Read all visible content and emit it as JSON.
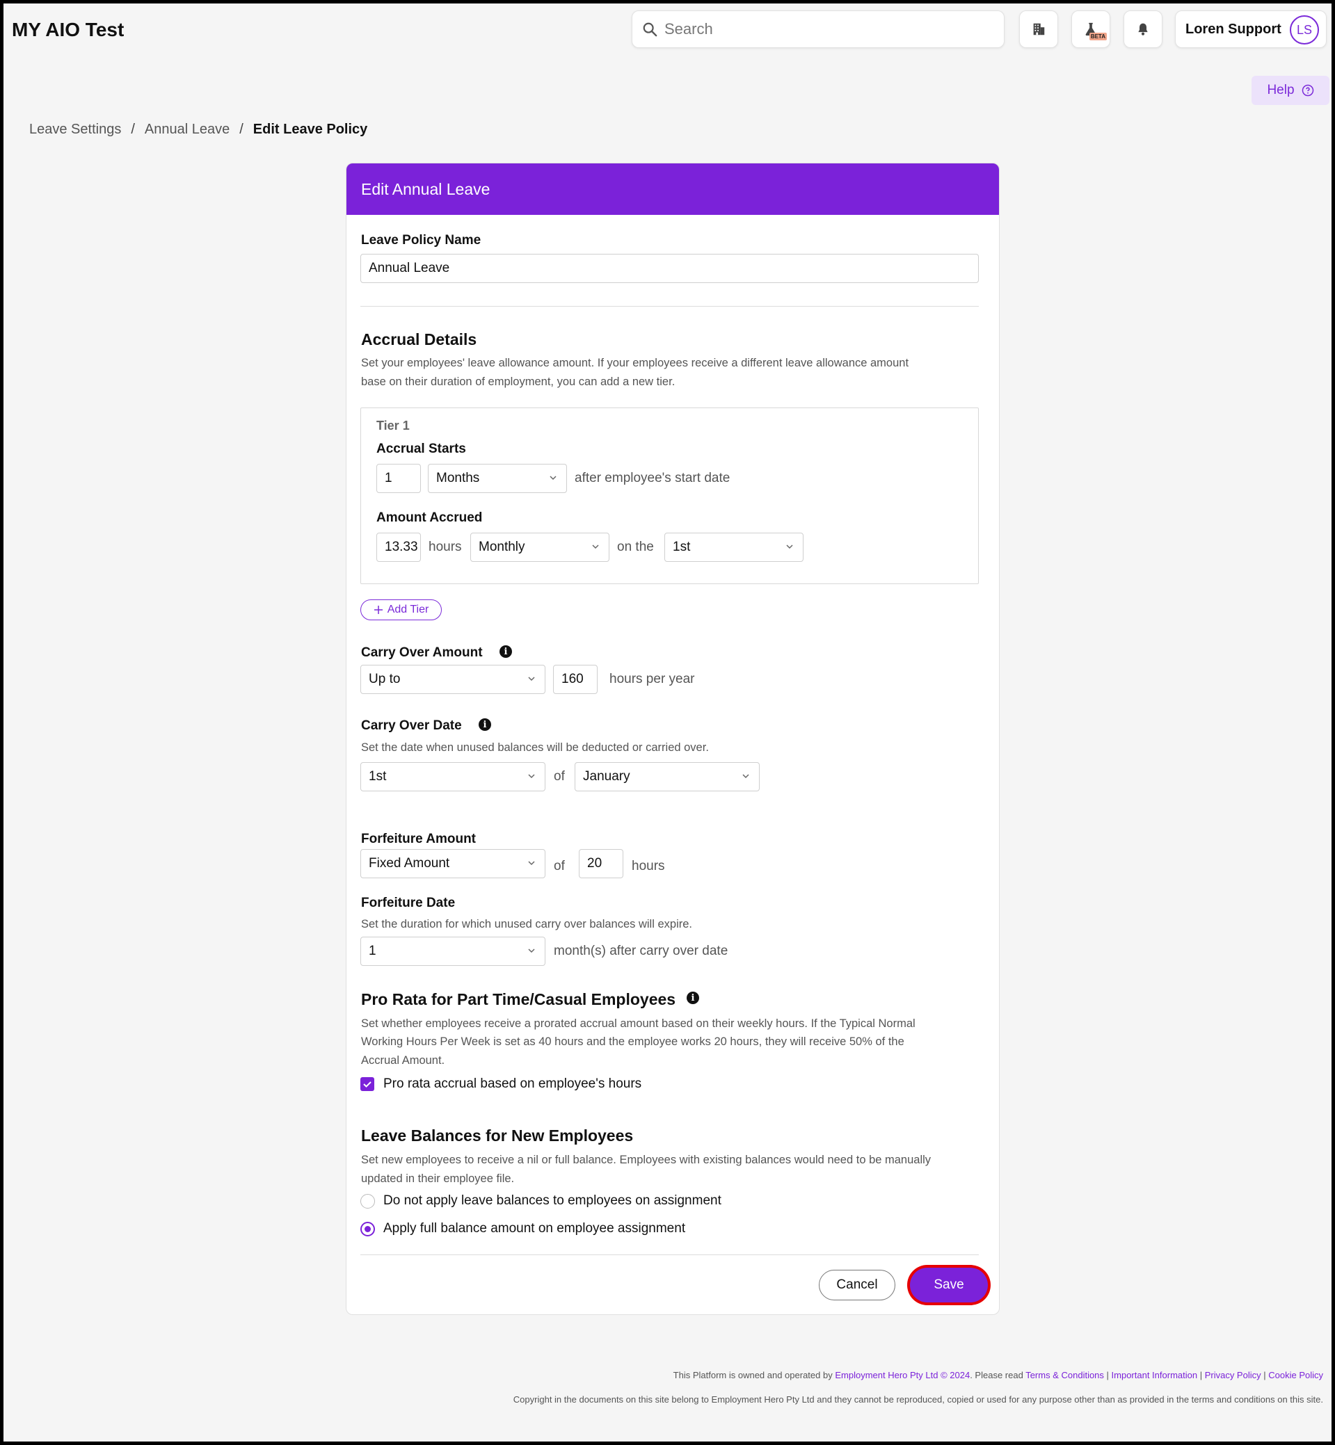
{
  "app": {
    "title": "MY AIO Test"
  },
  "search": {
    "placeholder": "Search"
  },
  "topbar": {
    "icons": [
      "building-icon",
      "beaker-beta-icon",
      "bell-icon"
    ],
    "beta_label": "BETA"
  },
  "user": {
    "name": "Loren Support",
    "initials": "LS"
  },
  "help": {
    "label": "Help"
  },
  "breadcrumb": {
    "items": [
      "Leave Settings",
      "Annual Leave"
    ],
    "current": "Edit Leave Policy",
    "separator": "/"
  },
  "form": {
    "header": "Edit Annual Leave",
    "policy_name": {
      "label": "Leave Policy Name",
      "value": "Annual Leave"
    },
    "accrual": {
      "title": "Accrual Details",
      "desc1": "Set your employees' leave allowance amount. If your employees receive a different leave allowance amount",
      "desc2": "base on their duration of employment, you can add a new tier.",
      "tier": {
        "name": "Tier 1",
        "starts_label": "Accrual Starts",
        "starts_value": "1",
        "starts_unit": "Months",
        "starts_suffix": "after employee's start date",
        "amount_label": "Amount Accrued",
        "amount_value": "13.33",
        "amount_unit": "hours",
        "frequency": "Monthly",
        "on_the": "on the",
        "day": "1st"
      },
      "add_tier": "Add Tier"
    },
    "carry_over_amount": {
      "label": "Carry Over Amount",
      "mode": "Up to",
      "value": "160",
      "suffix": "hours per year"
    },
    "carry_over_date": {
      "label": "Carry Over Date",
      "desc": "Set the date when unused balances will be deducted or carried over.",
      "day": "1st",
      "of": "of",
      "month": "January"
    },
    "forfeiture_amount": {
      "label": "Forfeiture Amount",
      "mode": "Fixed Amount",
      "of": "of",
      "value": "20",
      "suffix": "hours"
    },
    "forfeiture_date": {
      "label": "Forfeiture Date",
      "desc": "Set the duration for which unused carry over balances will expire.",
      "value": "1",
      "suffix": "month(s) after carry over date"
    },
    "pro_rata": {
      "title": "Pro Rata for Part Time/Casual Employees",
      "desc1": "Set whether employees receive a prorated accrual amount based on their weekly hours. If the Typical Normal",
      "desc2": "Working Hours Per Week is set as 40 hours and the employee works 20 hours, they will receive 50% of the",
      "desc3": "Accrual Amount.",
      "checkbox_label": "Pro rata accrual based on employee's hours",
      "checked": true
    },
    "new_employees": {
      "title": "Leave Balances for New Employees",
      "desc1": "Set new employees to receive a nil or full balance. Employees with existing balances would need to be manually",
      "desc2": "updated in their employee file.",
      "options": [
        "Do not apply leave balances to employees on assignment",
        "Apply full balance amount on employee assignment"
      ],
      "selected": 1
    },
    "cancel": "Cancel",
    "save": "Save"
  },
  "footer": {
    "line1_prefix": "This Platform is owned and operated by",
    "company": "Employment Hero Pty Ltd © 2024",
    "please_read": ". Please read",
    "links": [
      "Terms & Conditions",
      "Important Information",
      "Privacy Policy",
      "Cookie Policy"
    ],
    "copyright": "Copyright in the documents on this site belong to Employment Hero Pty Ltd and they cannot be reproduced, copied or used for any purpose other than as provided in the terms and conditions on this site."
  },
  "colors": {
    "brand": "#7b22d9",
    "highlight": "#e60000"
  }
}
